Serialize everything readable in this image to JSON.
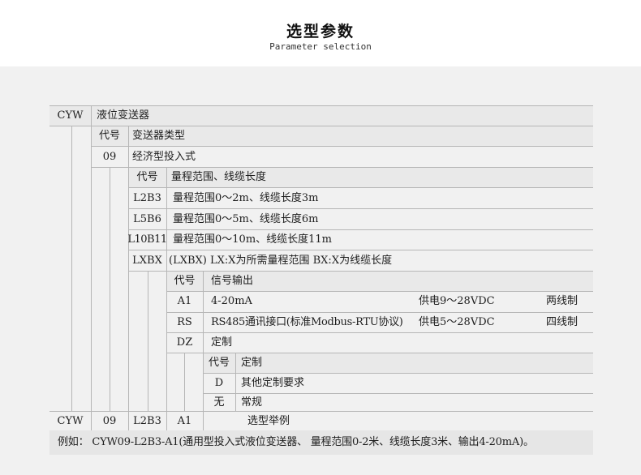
{
  "header": {
    "title": "选型参数",
    "subtitle": "Parameter selection"
  },
  "level1": {
    "code": "CYW",
    "name": "液位变送器"
  },
  "type_group": {
    "head_code": "代号",
    "head_desc": "变送器类型",
    "rows": [
      {
        "code": "09",
        "desc": "经济型投入式"
      }
    ]
  },
  "range_group": {
    "head_code": "代号",
    "head_desc": "量程范围、线缆长度",
    "rows": [
      {
        "code": "L2B3",
        "desc": "量程范围0～2m、线缆长度3m"
      },
      {
        "code": "L5B6",
        "desc": "量程范围0～5m、线缆长度6m"
      },
      {
        "code": "L10B11",
        "desc": "量程范围0～10m、线缆长度11m"
      },
      {
        "code": "LXBX",
        "desc": "(LXBX) LX:X为所需量程范围 BX:X为线缆长度"
      }
    ]
  },
  "signal_group": {
    "head_code": "代号",
    "head_desc": "信号输出",
    "rows": [
      {
        "code": "A1",
        "desc": "4-20mA",
        "power": "供电9～28VDC",
        "wire": "两线制"
      },
      {
        "code": "RS",
        "desc": "RS485通讯接口(标准Modbus-RTU协议)",
        "power": "供电5～28VDC",
        "wire": "四线制"
      },
      {
        "code": "DZ",
        "desc": "定制",
        "power": "",
        "wire": ""
      }
    ]
  },
  "custom_group": {
    "head_code": "代号",
    "head_desc": "定制",
    "rows": [
      {
        "code": "D",
        "desc": "其他定制要求"
      },
      {
        "code": "无",
        "desc": "常规"
      }
    ]
  },
  "example": {
    "codes": [
      "CYW",
      "09",
      "L2B3",
      "A1"
    ],
    "label": "选型举例",
    "note": "例如： CYW09-L2B3-A1(通用型投入式液位变送器、 量程范围0-2米、线缆长度3米、输出4-20mA)。"
  }
}
